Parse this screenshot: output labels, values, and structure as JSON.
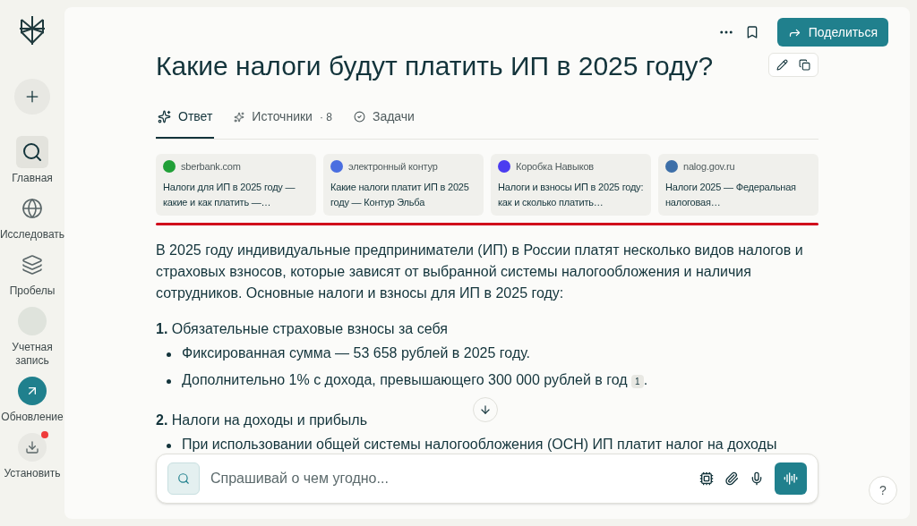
{
  "sidebar": {
    "items": [
      {
        "kind": "nav",
        "label": "Главная",
        "selected": true
      },
      {
        "kind": "nav",
        "label": "Исследовать",
        "selected": false
      },
      {
        "kind": "nav",
        "label": "Пробелы",
        "selected": false
      },
      {
        "kind": "account",
        "label": "Учетная запись",
        "selected": false
      },
      {
        "kind": "update",
        "label": "Обновление",
        "selected": false
      },
      {
        "kind": "install",
        "label": "Установить",
        "selected": false,
        "badge": true
      }
    ]
  },
  "header": {
    "share_button": "Поделиться"
  },
  "title": "Какие налоги будут платить ИП в 2025 году?",
  "tabs": [
    {
      "label": "Ответ",
      "selected": true
    },
    {
      "label": "Источники",
      "count": "· 8",
      "selected": false
    },
    {
      "label": "Задачи",
      "selected": false
    }
  ],
  "sources": [
    {
      "site": "sberbank.com",
      "title": "Налоги для ИП в 2025 году — какие и как платить —…",
      "color": "#21a038"
    },
    {
      "site": "электронный контур",
      "title": "Какие налоги платит ИП в 2025 году — Контур Эльба",
      "color": "#4a6ee0"
    },
    {
      "site": "Коробка Навыков",
      "title": "Налоги и взносы ИП в 2025 году: как и сколько платить…",
      "color": "#4b3cf0"
    },
    {
      "site": "nalog.gov.ru",
      "title": "Налоги 2025 — Федеральная налоговая…",
      "color": "#3d6fa8"
    }
  ],
  "answer": {
    "intro": "В 2025 году индивидуальные предприниматели (ИП) в России платят несколько видов налогов и страховых взносов, которые зависят от выбранной системы налогообложения и наличия сотрудников. Основные налоги и взносы для ИП в 2025 году:",
    "sections": [
      {
        "number": "1.",
        "heading": "Обязательные страховые взносы за себя",
        "bullets": [
          {
            "text": "Фиксированная сумма — 53 658 рублей в 2025 году."
          },
          {
            "text": "Дополнительно 1% с дохода, превышающего 300 000 рублей в год",
            "citation": "1",
            "end": "."
          }
        ]
      },
      {
        "number": "2.",
        "heading": "Налоги на доходы и прибыль",
        "bullets": [
          {
            "text": "При использовании общей системы налогообложения (ОСН) ИП платит налог на доходы"
          }
        ]
      }
    ]
  },
  "input": {
    "placeholder": "Спрашивай о чем угодно..."
  },
  "help_button": "?"
}
